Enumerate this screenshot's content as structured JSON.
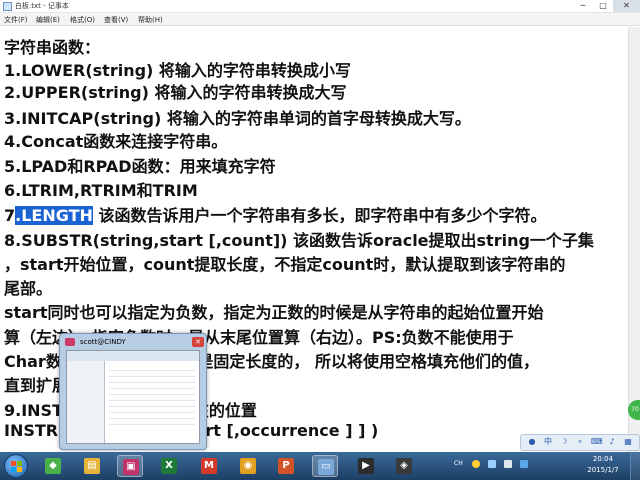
{
  "window": {
    "title": "白板.txt - 记事本",
    "min_glyph": "─",
    "max_glyph": "□",
    "close_glyph": "✕"
  },
  "menu": [
    {
      "label": "文件(F)"
    },
    {
      "label": "编辑(E)"
    },
    {
      "label": "格式(O)"
    },
    {
      "label": "查看(V)"
    },
    {
      "label": "帮助(H)"
    }
  ],
  "editor": {
    "selected_text": ".LENGTH",
    "lines": [
      {
        "text": "字符串函数："
      },
      {
        "text": "1.LOWER(string) 将输入的字符串转换成小写"
      },
      {
        "text": "2.UPPER(string) 将输入的字符串转换成大写"
      },
      {
        "text": "3.INITCAP(string) 将输入的字符串单词的首字母转换成大写。"
      },
      {
        "text": "4.Concat函数来连接字符串。"
      },
      {
        "text": "5.LPAD和RPAD函数：用来填充字符"
      },
      {
        "text": "6.LTRIM,RTRIM和TRIM"
      },
      {
        "prefix": "7",
        "selected": ".LENGTH",
        "suffix": " 该函数告诉用户一个字符串有多长，即字符串中有多少个字符。"
      },
      {
        "text": "8.SUBSTR(string,start [,count]) 该函数告诉oracle提取出string一个子集"
      },
      {
        "text": "，start开始位置，count提取长度，不指定count时，默认提取到该字符串的"
      },
      {
        "text": "尾部。"
      },
      {
        "text": "  start同时也可以指定为负数，指定为正数的时候是从字符串的起始位置开始"
      },
      {
        "text": "算（左边），指定负数时，是从末尾位置算（右边）。PS:负数不能使用于"
      },
      {
        "text": "Char数据类型，因为char是固定长度的，   所以将使用空格填充他们的值，"
      },
      {
        "text": "直到扩展到列的全长。"
      },
      {
        "text": "9.INSTR 查找子字符串所在的位置"
      },
      {
        "text": "  INSTR(string, set [,start [,occurrence ] ] )"
      }
    ]
  },
  "thumbnail": {
    "title": "scott@CINDY",
    "close_glyph": "✕"
  },
  "float_button": {
    "label": "70"
  },
  "ime_bar": {
    "items": [
      "●",
      "中",
      "☽",
      "∘",
      "⌨",
      "♪",
      "▦"
    ]
  },
  "taskbar": {
    "apps": [
      {
        "name": "360",
        "color": "#49b04a",
        "glyph": "◆"
      },
      {
        "name": "explorer",
        "color": "#e7b43a",
        "glyph": "▤"
      },
      {
        "name": "oracle",
        "color": "#c2336a",
        "glyph": "▣"
      },
      {
        "name": "excel",
        "color": "#1f7a3a",
        "glyph": "X"
      },
      {
        "name": "foxmail",
        "color": "#d33a2c",
        "glyph": "M"
      },
      {
        "name": "chrome",
        "color": "#e0a020",
        "glyph": "◉"
      },
      {
        "name": "powerpoint",
        "color": "#d2532a",
        "glyph": "P"
      },
      {
        "name": "notepad",
        "color": "#7aa8d8",
        "glyph": "▭"
      },
      {
        "name": "terminal",
        "color": "#2c2c2c",
        "glyph": "▶"
      },
      {
        "name": "recorder",
        "color": "#3a3a3a",
        "glyph": "◈"
      }
    ],
    "tray_lang": "CH",
    "clock_time": "20:04",
    "clock_date": "2015/1/7"
  }
}
